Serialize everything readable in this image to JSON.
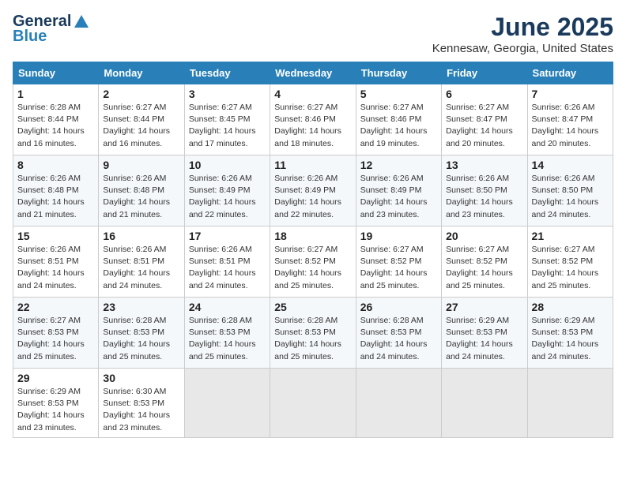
{
  "logo": {
    "general": "General",
    "blue": "Blue"
  },
  "title": {
    "month": "June 2025",
    "location": "Kennesaw, Georgia, United States"
  },
  "weekdays": [
    "Sunday",
    "Monday",
    "Tuesday",
    "Wednesday",
    "Thursday",
    "Friday",
    "Saturday"
  ],
  "weeks": [
    [
      {
        "day": "1",
        "sunrise": "6:28 AM",
        "sunset": "8:44 PM",
        "daylight": "14 hours and 16 minutes."
      },
      {
        "day": "2",
        "sunrise": "6:27 AM",
        "sunset": "8:44 PM",
        "daylight": "14 hours and 16 minutes."
      },
      {
        "day": "3",
        "sunrise": "6:27 AM",
        "sunset": "8:45 PM",
        "daylight": "14 hours and 17 minutes."
      },
      {
        "day": "4",
        "sunrise": "6:27 AM",
        "sunset": "8:46 PM",
        "daylight": "14 hours and 18 minutes."
      },
      {
        "day": "5",
        "sunrise": "6:27 AM",
        "sunset": "8:46 PM",
        "daylight": "14 hours and 19 minutes."
      },
      {
        "day": "6",
        "sunrise": "6:27 AM",
        "sunset": "8:47 PM",
        "daylight": "14 hours and 20 minutes."
      },
      {
        "day": "7",
        "sunrise": "6:26 AM",
        "sunset": "8:47 PM",
        "daylight": "14 hours and 20 minutes."
      }
    ],
    [
      {
        "day": "8",
        "sunrise": "6:26 AM",
        "sunset": "8:48 PM",
        "daylight": "14 hours and 21 minutes."
      },
      {
        "day": "9",
        "sunrise": "6:26 AM",
        "sunset": "8:48 PM",
        "daylight": "14 hours and 21 minutes."
      },
      {
        "day": "10",
        "sunrise": "6:26 AM",
        "sunset": "8:49 PM",
        "daylight": "14 hours and 22 minutes."
      },
      {
        "day": "11",
        "sunrise": "6:26 AM",
        "sunset": "8:49 PM",
        "daylight": "14 hours and 22 minutes."
      },
      {
        "day": "12",
        "sunrise": "6:26 AM",
        "sunset": "8:49 PM",
        "daylight": "14 hours and 23 minutes."
      },
      {
        "day": "13",
        "sunrise": "6:26 AM",
        "sunset": "8:50 PM",
        "daylight": "14 hours and 23 minutes."
      },
      {
        "day": "14",
        "sunrise": "6:26 AM",
        "sunset": "8:50 PM",
        "daylight": "14 hours and 24 minutes."
      }
    ],
    [
      {
        "day": "15",
        "sunrise": "6:26 AM",
        "sunset": "8:51 PM",
        "daylight": "14 hours and 24 minutes."
      },
      {
        "day": "16",
        "sunrise": "6:26 AM",
        "sunset": "8:51 PM",
        "daylight": "14 hours and 24 minutes."
      },
      {
        "day": "17",
        "sunrise": "6:26 AM",
        "sunset": "8:51 PM",
        "daylight": "14 hours and 24 minutes."
      },
      {
        "day": "18",
        "sunrise": "6:27 AM",
        "sunset": "8:52 PM",
        "daylight": "14 hours and 25 minutes."
      },
      {
        "day": "19",
        "sunrise": "6:27 AM",
        "sunset": "8:52 PM",
        "daylight": "14 hours and 25 minutes."
      },
      {
        "day": "20",
        "sunrise": "6:27 AM",
        "sunset": "8:52 PM",
        "daylight": "14 hours and 25 minutes."
      },
      {
        "day": "21",
        "sunrise": "6:27 AM",
        "sunset": "8:52 PM",
        "daylight": "14 hours and 25 minutes."
      }
    ],
    [
      {
        "day": "22",
        "sunrise": "6:27 AM",
        "sunset": "8:53 PM",
        "daylight": "14 hours and 25 minutes."
      },
      {
        "day": "23",
        "sunrise": "6:28 AM",
        "sunset": "8:53 PM",
        "daylight": "14 hours and 25 minutes."
      },
      {
        "day": "24",
        "sunrise": "6:28 AM",
        "sunset": "8:53 PM",
        "daylight": "14 hours and 25 minutes."
      },
      {
        "day": "25",
        "sunrise": "6:28 AM",
        "sunset": "8:53 PM",
        "daylight": "14 hours and 25 minutes."
      },
      {
        "day": "26",
        "sunrise": "6:28 AM",
        "sunset": "8:53 PM",
        "daylight": "14 hours and 24 minutes."
      },
      {
        "day": "27",
        "sunrise": "6:29 AM",
        "sunset": "8:53 PM",
        "daylight": "14 hours and 24 minutes."
      },
      {
        "day": "28",
        "sunrise": "6:29 AM",
        "sunset": "8:53 PM",
        "daylight": "14 hours and 24 minutes."
      }
    ],
    [
      {
        "day": "29",
        "sunrise": "6:29 AM",
        "sunset": "8:53 PM",
        "daylight": "14 hours and 23 minutes."
      },
      {
        "day": "30",
        "sunrise": "6:30 AM",
        "sunset": "8:53 PM",
        "daylight": "14 hours and 23 minutes."
      },
      null,
      null,
      null,
      null,
      null
    ]
  ],
  "labels": {
    "sunrise": "Sunrise:",
    "sunset": "Sunset:",
    "daylight": "Daylight:"
  }
}
